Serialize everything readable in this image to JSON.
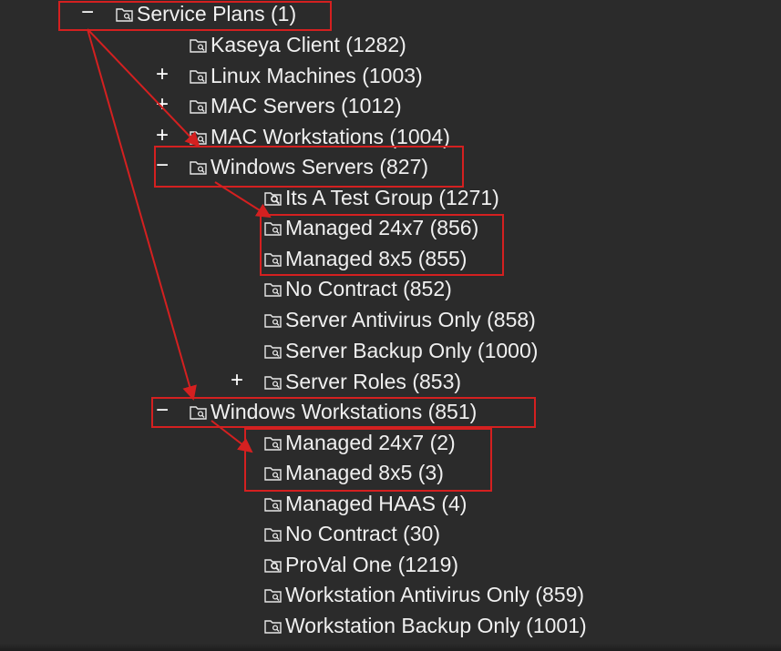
{
  "tree": {
    "collapse_symbol": "−",
    "expand_symbol": "+",
    "root": {
      "label": "Service Plans (1)",
      "toggle": "−"
    },
    "level1": [
      {
        "label": "Kaseya Client (1282)",
        "toggle": ""
      },
      {
        "label": "Linux Machines (1003)",
        "toggle": "+"
      },
      {
        "label": "MAC Servers (1012)",
        "toggle": "+"
      },
      {
        "label": "MAC Workstations (1004)",
        "toggle": "+"
      },
      {
        "label": "Windows Servers (827)",
        "toggle": "−"
      }
    ],
    "windows_servers_children": [
      {
        "label": "Its A Test Group (1271)",
        "toggle": ""
      },
      {
        "label": "Managed 24x7 (856)",
        "toggle": ""
      },
      {
        "label": "Managed 8x5 (855)",
        "toggle": ""
      },
      {
        "label": "No Contract (852)",
        "toggle": ""
      },
      {
        "label": "Server Antivirus Only (858)",
        "toggle": ""
      },
      {
        "label": "Server Backup Only (1000)",
        "toggle": ""
      },
      {
        "label": "Server Roles (853)",
        "toggle": "+"
      }
    ],
    "windows_workstations": {
      "label": "Windows Workstations (851)",
      "toggle": "−"
    },
    "windows_workstations_children": [
      {
        "label": "Managed 24x7 (2)",
        "toggle": ""
      },
      {
        "label": "Managed 8x5 (3)",
        "toggle": ""
      },
      {
        "label": "Managed HAAS (4)",
        "toggle": ""
      },
      {
        "label": "No Contract (30)",
        "toggle": ""
      },
      {
        "label": "ProVal One (1219)",
        "toggle": ""
      },
      {
        "label": "Workstation Antivirus Only (859)",
        "toggle": ""
      },
      {
        "label": "Workstation Backup Only (1001)",
        "toggle": ""
      }
    ]
  },
  "colors": {
    "background": "#2b2b2b",
    "text": "#f0f0f0",
    "annotation": "#d42020"
  },
  "icons": {
    "folder": "folder-search-icon",
    "folder_alt": "folder-magnify-icon"
  }
}
